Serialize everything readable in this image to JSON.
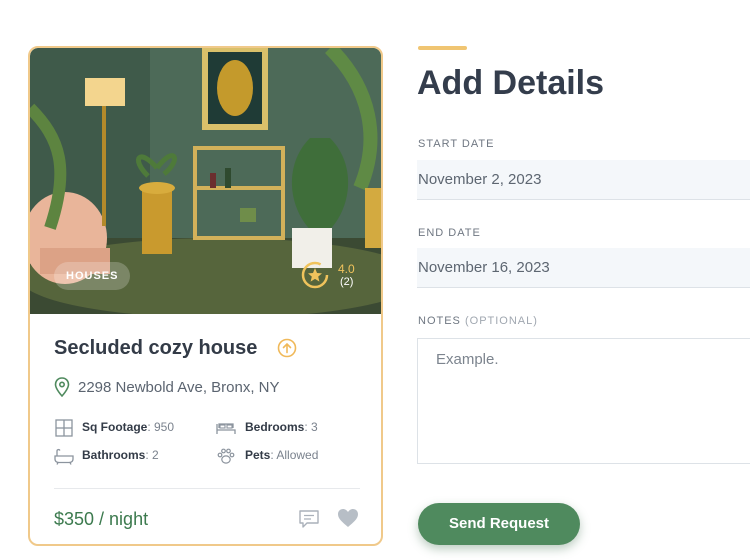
{
  "listing": {
    "category_badge": "HOUSES",
    "rating_score": "4.0",
    "rating_count": "(2)",
    "title": "Secluded cozy house",
    "address": "2298 Newbold Ave, Bronx, NY",
    "features": [
      {
        "key": "Sq Footage",
        "value": ": 950",
        "icon": "floorplan-icon"
      },
      {
        "key": "Bedrooms",
        "value": ": 3",
        "icon": "bed-icon"
      },
      {
        "key": "Bathrooms",
        "value": ": 2",
        "icon": "bathtub-icon"
      },
      {
        "key": "Pets",
        "value": ": Allowed",
        "icon": "paw-icon"
      }
    ],
    "price": "$350 / night"
  },
  "form": {
    "heading": "Add Details",
    "start_date_label": "START DATE",
    "start_date_value": "November 2, 2023",
    "end_date_label": "END DATE",
    "end_date_value": "November 16, 2023",
    "notes_label": "NOTES",
    "notes_optional": "(OPTIONAL)",
    "notes_placeholder": "Example.",
    "submit_label": "Send Request"
  },
  "colors": {
    "accent": "#f0c572",
    "primary_green": "#4f8a5e",
    "card_border": "#f0c98a"
  }
}
